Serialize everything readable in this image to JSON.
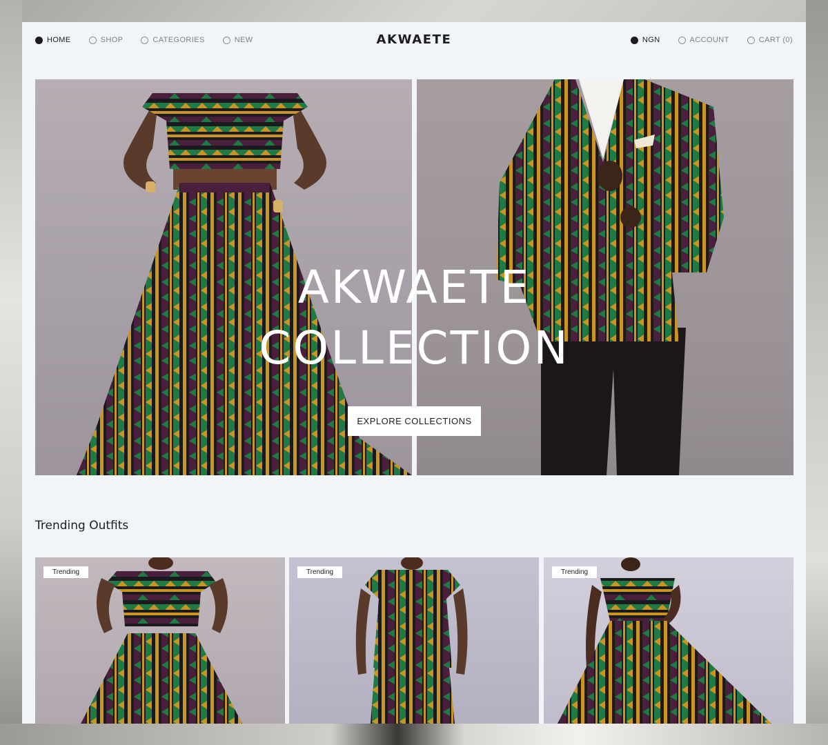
{
  "nav": {
    "left": [
      {
        "label": "HOME",
        "active": true
      },
      {
        "label": "SHOP",
        "active": false
      },
      {
        "label": "CATEGORIES",
        "active": false
      },
      {
        "label": "NEW",
        "active": false
      }
    ],
    "brand": "AKWAETE",
    "right": [
      {
        "label": "NGN",
        "active": true
      },
      {
        "label": "ACCOUNT",
        "active": false
      },
      {
        "label": "CART (0)",
        "active": false
      }
    ]
  },
  "hero": {
    "title_line1": "AKWAETE",
    "title_line2": "COLLECTION",
    "cta_label": "EXPLORE COLLECTIONS"
  },
  "trending": {
    "title": "Trending Outfits",
    "cards": [
      {
        "badge": "Trending"
      },
      {
        "badge": "Trending"
      },
      {
        "badge": "Trending"
      }
    ]
  },
  "colors": {
    "page_bg": "#f1f4f8",
    "text": "#1d1d1f",
    "muted": "#7d7f83",
    "fabric_green": "#1f7a43",
    "fabric_gold": "#c99420",
    "fabric_plum": "#4a1f3b",
    "fabric_dark": "#1b1a1f"
  }
}
